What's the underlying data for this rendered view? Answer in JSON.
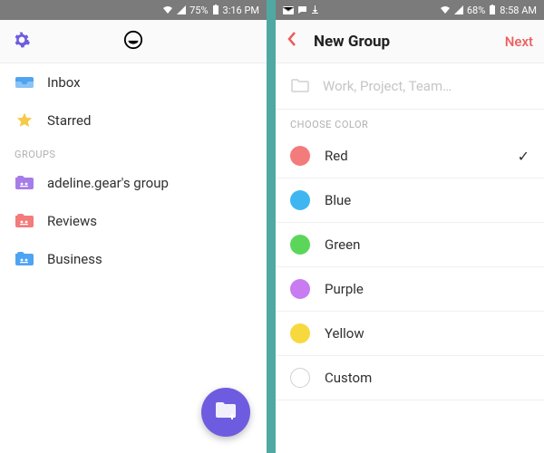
{
  "left": {
    "status": {
      "signal": "75%",
      "time": "3:16 PM"
    },
    "nav": {
      "inbox": "Inbox",
      "starred": "Starred"
    },
    "groups_label": "GROUPS",
    "groups": [
      {
        "label": "adeline.gear's group",
        "color": "#a67de8"
      },
      {
        "label": "Reviews",
        "color": "#f47b7b"
      },
      {
        "label": "Business",
        "color": "#4ea4f2"
      }
    ]
  },
  "right": {
    "status": {
      "signal": "68%",
      "time": "8:58 AM"
    },
    "title": "New Group",
    "next": "Next",
    "name_placeholder": "Work, Project, Team…",
    "choose_label": "CHOOSE COLOR",
    "colors": [
      {
        "label": "Red",
        "hex": "#f47b7b",
        "selected": true
      },
      {
        "label": "Blue",
        "hex": "#3fb6f2",
        "selected": false
      },
      {
        "label": "Green",
        "hex": "#5bd65b",
        "selected": false
      },
      {
        "label": "Purple",
        "hex": "#c97bf2",
        "selected": false
      },
      {
        "label": "Yellow",
        "hex": "#f7d93f",
        "selected": false
      },
      {
        "label": "Custom",
        "hex": "",
        "selected": false
      }
    ]
  }
}
